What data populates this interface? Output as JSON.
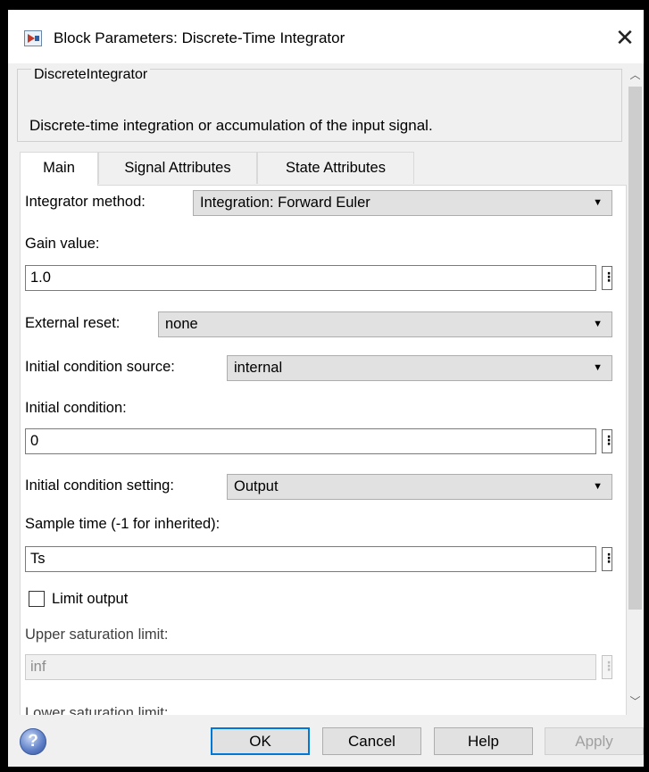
{
  "window": {
    "title": "Block Parameters: Discrete-Time Integrator",
    "close_glyph": "✕"
  },
  "block": {
    "type_name": "DiscreteIntegrator",
    "description": "Discrete-time integration or accumulation of the input signal."
  },
  "tabs": [
    {
      "label": "Main",
      "active": true
    },
    {
      "label": "Signal Attributes",
      "active": false
    },
    {
      "label": "State Attributes",
      "active": false
    }
  ],
  "params": {
    "integrator_method": {
      "label": "Integrator method:",
      "value": "Integration: Forward Euler"
    },
    "gain_value": {
      "label": "Gain value:",
      "value": "1.0"
    },
    "external_reset": {
      "label": "External reset:",
      "value": "none"
    },
    "ic_source": {
      "label": "Initial condition source:",
      "value": "internal"
    },
    "initial_condition": {
      "label": "Initial condition:",
      "value": "0"
    },
    "ic_setting": {
      "label": "Initial condition setting:",
      "value": "Output"
    },
    "sample_time": {
      "label": "Sample time (-1 for inherited):",
      "value": "Ts"
    },
    "limit_output": {
      "label": "Limit output",
      "checked": false
    },
    "upper_sat": {
      "label": "Upper saturation limit:",
      "value": "inf",
      "enabled": false
    },
    "lower_sat": {
      "label": "Lower saturation limit:"
    }
  },
  "more_glyph": "⋮",
  "buttons": {
    "ok": "OK",
    "cancel": "Cancel",
    "help": "Help",
    "apply": "Apply",
    "help_icon": "?"
  },
  "icons": [
    "simulink-block-icon",
    "close-icon",
    "chevron-up-icon",
    "chevron-down-icon",
    "help-icon"
  ],
  "colors": {
    "focus_border": "#0078d7",
    "panel_bg": "#f0f0f0"
  }
}
